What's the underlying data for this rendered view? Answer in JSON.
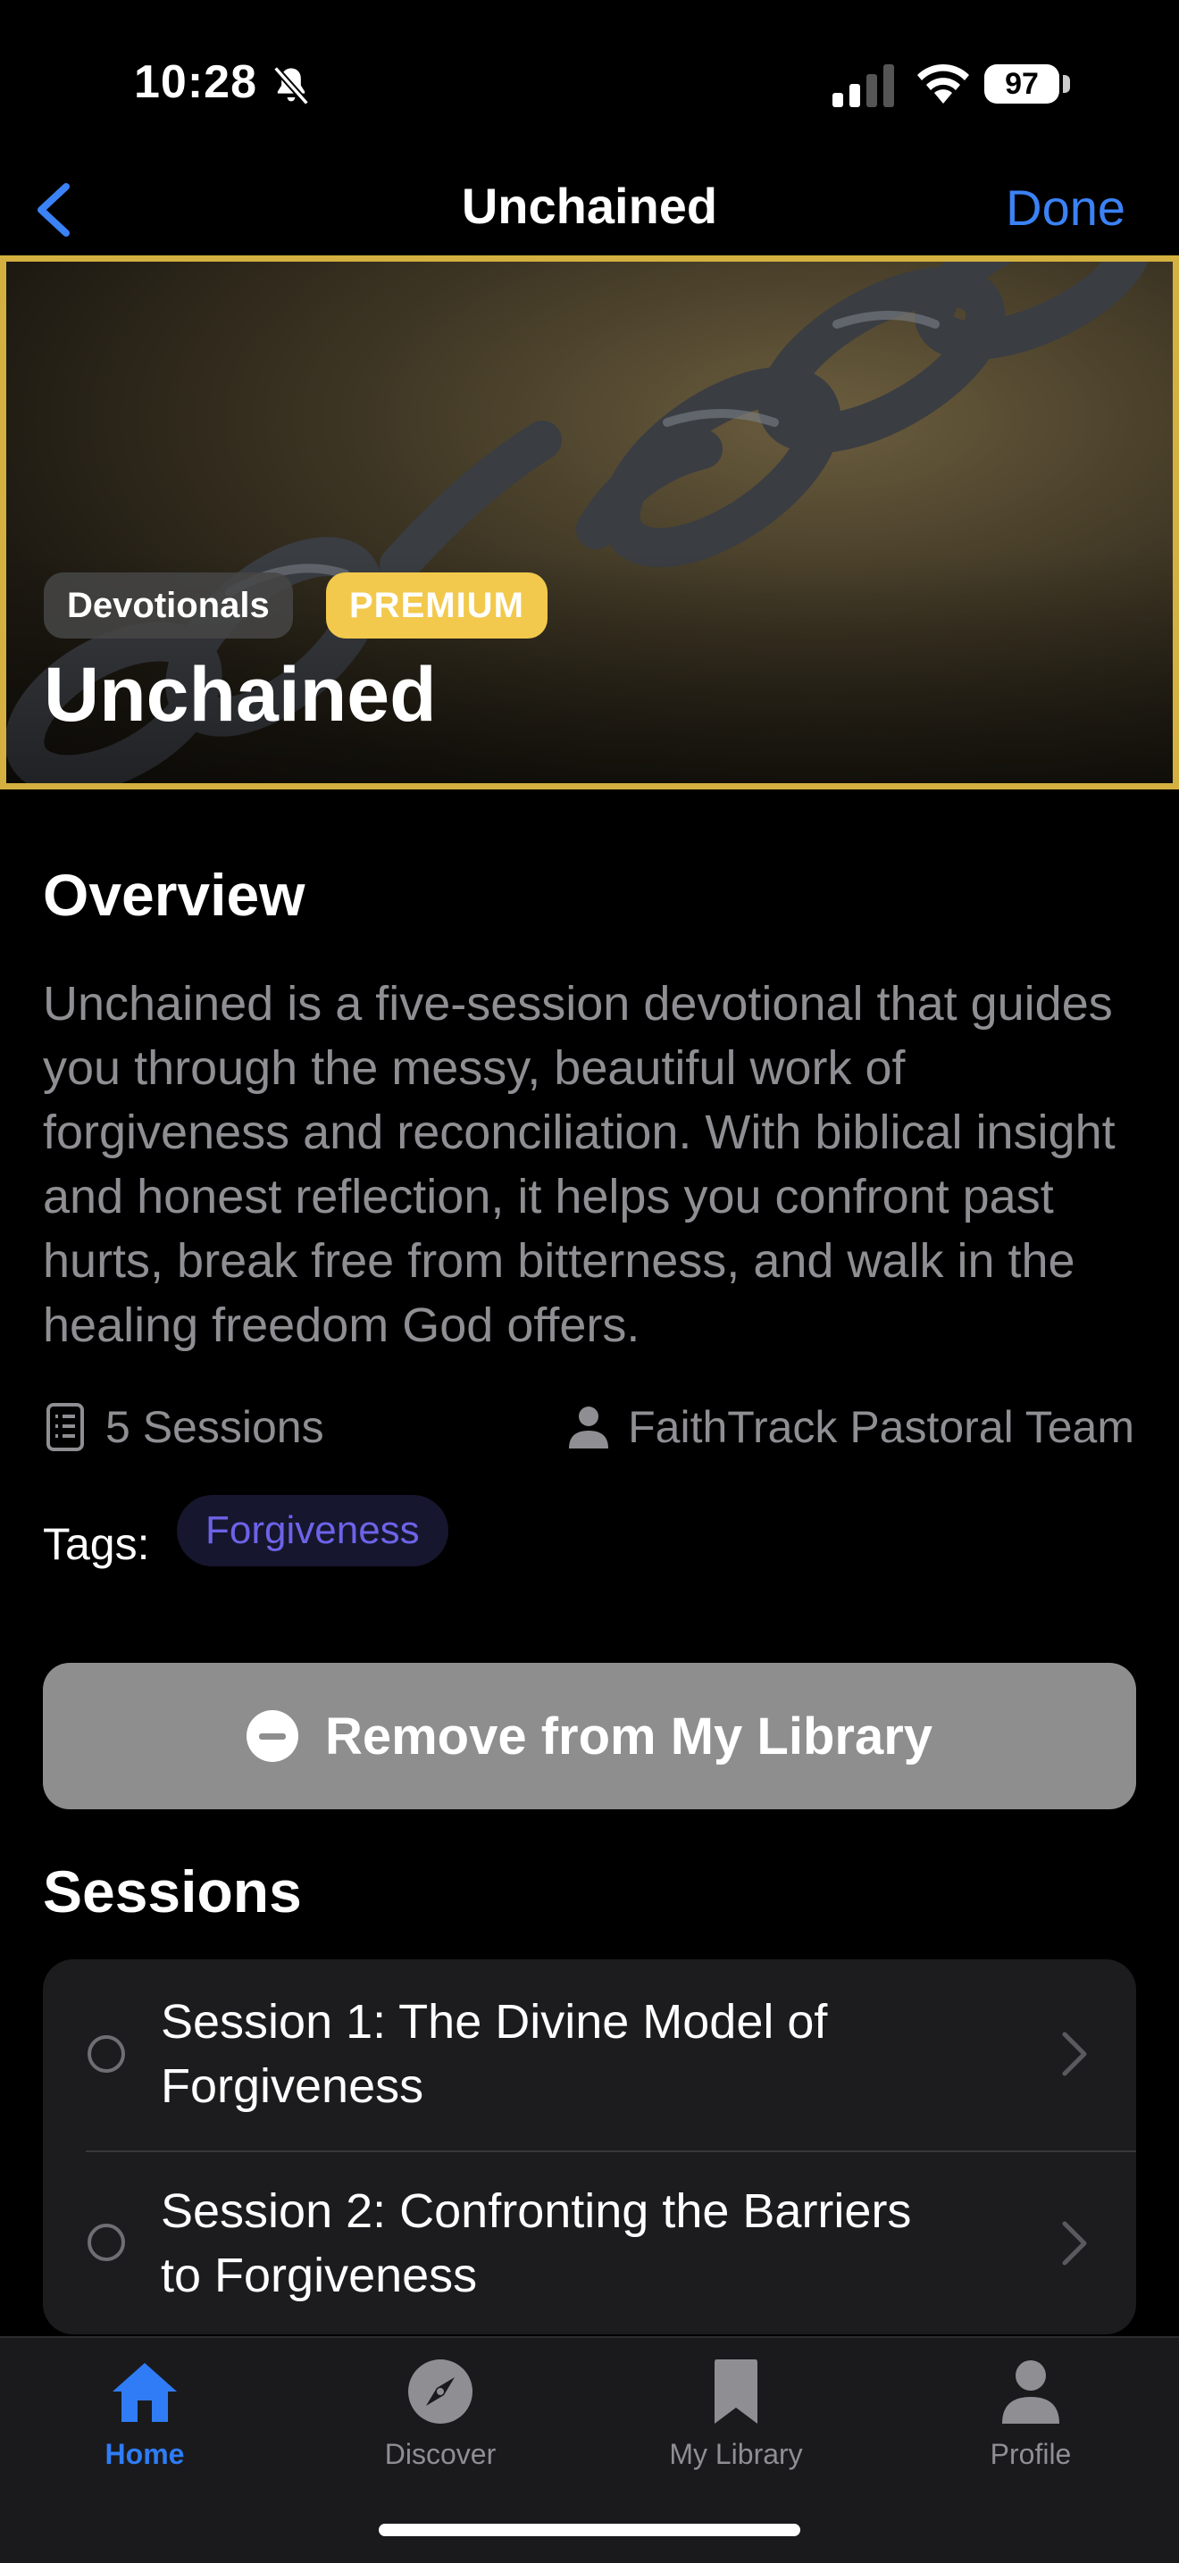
{
  "status_bar": {
    "time": "10:28",
    "battery": "97"
  },
  "nav": {
    "title": "Unchained",
    "done_label": "Done"
  },
  "hero": {
    "category": "Devotionals",
    "badge": "PREMIUM",
    "title": "Unchained"
  },
  "overview": {
    "heading": "Overview",
    "text": "Unchained is a five-session devotional that guides you through the messy, beautiful work of forgiveness and reconciliation. With biblical insight and honest reflection, it helps you confront past hurts, break free from bitterness, and walk in the healing freedom God offers.",
    "sessions_count": "5 Sessions",
    "author": "FaithTrack Pastoral Team",
    "tags_label": "Tags:",
    "tags": [
      "Forgiveness"
    ]
  },
  "library_button": {
    "label": "Remove from My Library"
  },
  "sessions": {
    "heading": "Sessions",
    "items": [
      {
        "line1": "Session 1: The Divine Model of",
        "line2": "Forgiveness"
      },
      {
        "line1": "Session 2: Confronting the Barriers",
        "line2": "to Forgiveness"
      }
    ]
  },
  "tabbar": {
    "items": [
      {
        "label": "Home",
        "icon": "home-icon",
        "active": true
      },
      {
        "label": "Discover",
        "icon": "compass-icon",
        "active": false
      },
      {
        "label": "My Library",
        "icon": "bookmark-icon",
        "active": false
      },
      {
        "label": "Profile",
        "icon": "person-icon",
        "active": false
      }
    ]
  },
  "colors": {
    "accent": "#3b82f6",
    "premium": "#f2c94c",
    "hero_border": "#d4b040",
    "tag_text": "#6d63e8"
  }
}
